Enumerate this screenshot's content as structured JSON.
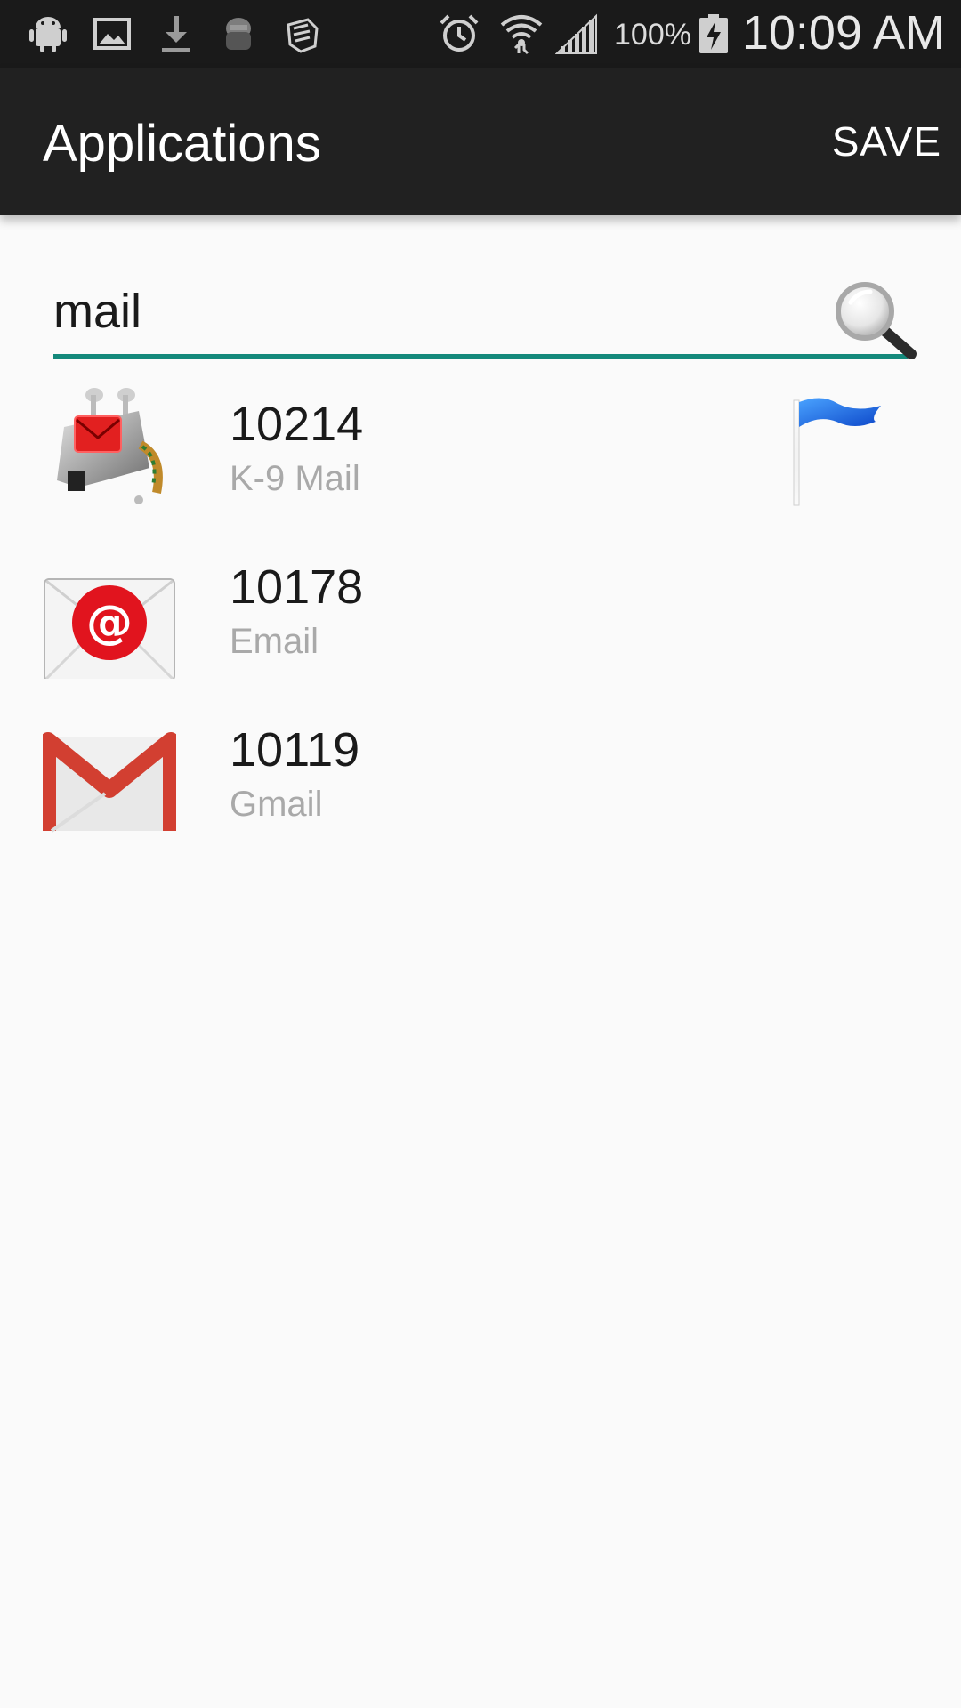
{
  "status_bar": {
    "icons_left": [
      "android-icon",
      "image-icon",
      "download-icon",
      "spy-icon",
      "fist-icon"
    ],
    "icons_right": [
      "alarm-icon",
      "wifi-icon",
      "signal-icon",
      "battery-charging-icon"
    ],
    "battery": "100%",
    "time": "10:09 AM"
  },
  "app_bar": {
    "title": "Applications",
    "save_label": "SAVE"
  },
  "search": {
    "value": "mail",
    "underline_color": "#14897b",
    "icon": "magnifier-icon"
  },
  "apps": [
    {
      "uid": "10214",
      "name": "K-9 Mail",
      "icon": "k9-mail-icon",
      "flagged": true
    },
    {
      "uid": "10178",
      "name": "Email",
      "icon": "email-icon",
      "flagged": false
    },
    {
      "uid": "10119",
      "name": "Gmail",
      "icon": "gmail-icon",
      "flagged": false
    }
  ],
  "colors": {
    "status_bar": "#1a1a1a",
    "app_bar": "#212121",
    "background": "#fafafa",
    "secondary_text": "#a9a9a9",
    "flag": "#1f6fe0"
  }
}
